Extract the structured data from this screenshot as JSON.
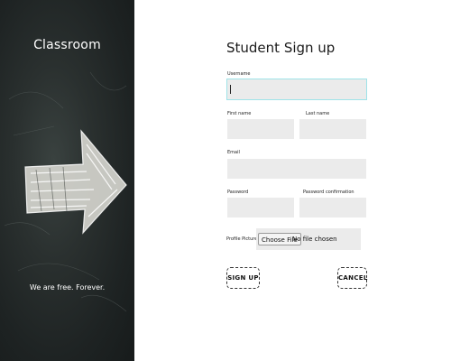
{
  "brand": {
    "name": "Classroom",
    "tagline": "We are free. Forever."
  },
  "form": {
    "title": "Student Sign up",
    "username": {
      "label": "Username",
      "value": ""
    },
    "first_name": {
      "label": "First name",
      "value": ""
    },
    "last_name": {
      "label": "Last name",
      "value": ""
    },
    "email": {
      "label": "Email",
      "value": ""
    },
    "password": {
      "label": "Password",
      "value": ""
    },
    "password_confirmation": {
      "label": "Password confirmation",
      "value": ""
    },
    "profile_picture": {
      "label": "Profile Picture",
      "button_label": "Choose File",
      "status": "No file chosen"
    },
    "submit_label": "SIGN UP",
    "cancel_label": "CANCEL"
  }
}
